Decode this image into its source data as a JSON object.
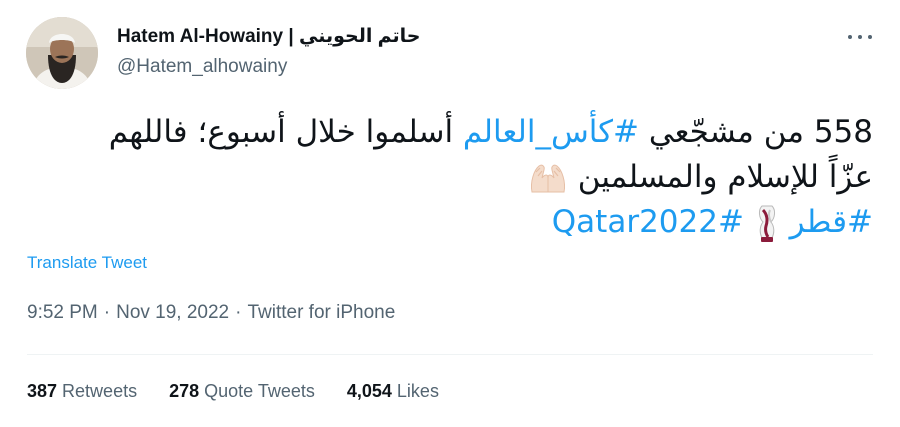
{
  "author": {
    "display_name": "Hatem Al-Howainy | حاتم الحويني",
    "handle": "@Hatem_alhowainy"
  },
  "tweet": {
    "line1_prefix": "558 من مشجّعي ",
    "line1_hashtag": "#كأس_العالم",
    "line1_suffix": " أسلموا خلال أسبوع؛ فاللهم",
    "line2_text": "عزّاً للإسلام والمسلمين",
    "line2_emoji": "raising-hands-emoji",
    "line3_hashtag1": "#قطر",
    "line3_emoji": "world-cup-trophy-emoji",
    "line3_hashtag2": "#Qatar2022"
  },
  "translate_label": "Translate Tweet",
  "meta": {
    "time": "9:52 PM",
    "date": "Nov 19, 2022",
    "source": "Twitter for iPhone",
    "separator": "·"
  },
  "stats": [
    {
      "count": "387",
      "label": "Retweets"
    },
    {
      "count": "278",
      "label": "Quote Tweets"
    },
    {
      "count": "4,054",
      "label": "Likes"
    }
  ],
  "colors": {
    "link": "#1d9bf0",
    "text": "#0f1419",
    "secondary": "#536471"
  },
  "icons": {
    "more": "more-horizontal-icon"
  }
}
